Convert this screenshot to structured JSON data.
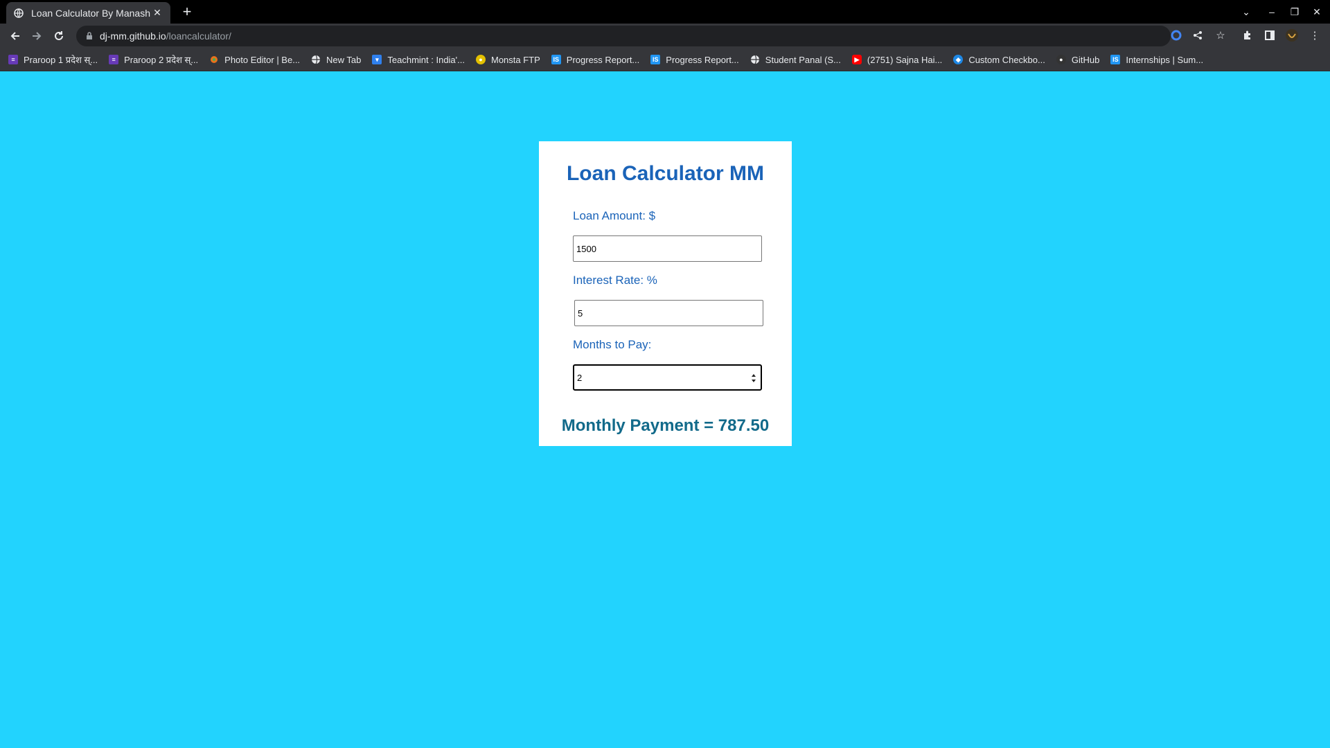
{
  "browser": {
    "tab_title": "Loan Calculator By Manash",
    "url_host": "dj-mm.github.io",
    "url_path": "/loancalculator/",
    "bookmarks": [
      {
        "label": "Praroop 1 प्रदेश स्...",
        "icon": "forms-icon",
        "color": "#673ab7"
      },
      {
        "label": "Praroop 2 प्रदेश स्...",
        "icon": "forms-icon",
        "color": "#673ab7"
      },
      {
        "label": "Photo Editor | Be...",
        "icon": "photo-editor-icon",
        "color": "#e9711c"
      },
      {
        "label": "New Tab",
        "icon": "globe-icon",
        "color": "#5f6368"
      },
      {
        "label": "Teachmint : India'...",
        "icon": "teachmint-icon",
        "color": "#2f80ed"
      },
      {
        "label": "Monsta FTP",
        "icon": "monsta-icon",
        "color": "#e3c000"
      },
      {
        "label": "Progress Report...",
        "icon": "is-icon",
        "color": "#2196f3"
      },
      {
        "label": "Progress Report...",
        "icon": "is-icon",
        "color": "#2196f3"
      },
      {
        "label": "Student Panal (S...",
        "icon": "globe-icon",
        "color": "#5f6368"
      },
      {
        "label": "(2751) Sajna Hai...",
        "icon": "youtube-icon",
        "color": "#ff0000"
      },
      {
        "label": "Custom Checkbo...",
        "icon": "codepen-icon",
        "color": "#1e88e5"
      },
      {
        "label": "GitHub",
        "icon": "github-icon",
        "color": "#333333"
      },
      {
        "label": "Internships | Sum...",
        "icon": "is-icon",
        "color": "#2196f3"
      }
    ]
  },
  "calculator": {
    "title": "Loan Calculator MM",
    "loan_amount_label": "Loan Amount: $",
    "loan_amount_value": "1500",
    "interest_rate_label": "Interest Rate: %",
    "interest_rate_value": "5",
    "months_label": "Months to Pay:",
    "months_value": "2",
    "result_text": "Monthly Payment = 787.50"
  },
  "colors": {
    "page_background": "#22d3fe",
    "heading": "#1a63b8",
    "result": "#126a8a"
  }
}
